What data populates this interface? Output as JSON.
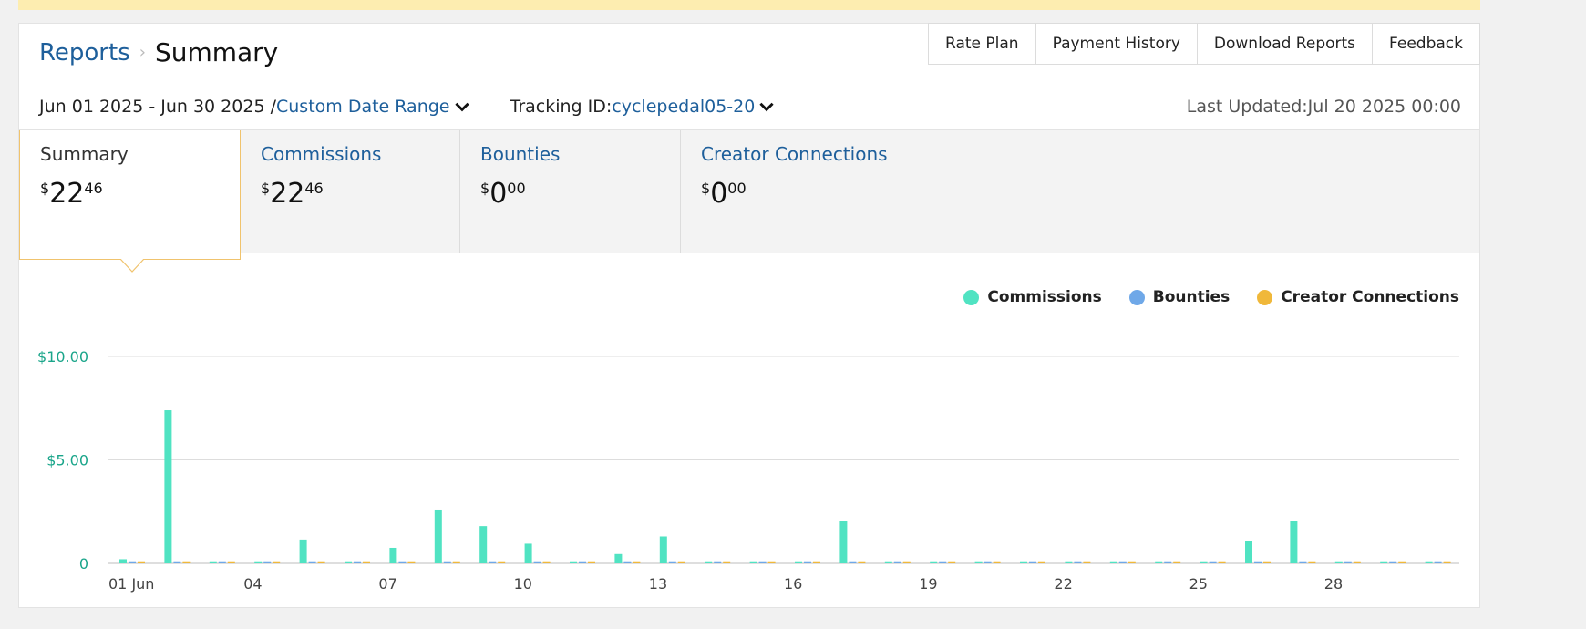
{
  "breadcrumb": {
    "parent": "Reports",
    "separator": "›",
    "current": "Summary"
  },
  "header_tabs": [
    "Rate Plan",
    "Payment History",
    "Download Reports",
    "Feedback"
  ],
  "filters": {
    "date_range": "Jun 01 2025 - Jun 30 2025 /",
    "date_mode": "Custom Date Range",
    "tracking_label": "Tracking ID:",
    "tracking_id": "cyclepedal05-20",
    "last_updated": "Last Updated:Jul 20 2025 00:00"
  },
  "metrics": [
    {
      "label": "Summary",
      "currency": "$",
      "whole": "22",
      "cents": "46",
      "active": true
    },
    {
      "label": "Commissions",
      "currency": "$",
      "whole": "22",
      "cents": "46",
      "active": false
    },
    {
      "label": "Bounties",
      "currency": "$",
      "whole": "0",
      "cents": "00",
      "active": false
    },
    {
      "label": "Creator Connections",
      "currency": "$",
      "whole": "0",
      "cents": "00",
      "active": false
    }
  ],
  "colors": {
    "commissions": "#50e3c2",
    "bounties": "#6fa8e8",
    "creator_connections": "#f0b83a",
    "accent_link": "#1e5f9b",
    "y_tick": "#1aa58a"
  },
  "chart_data": {
    "type": "bar",
    "x": [
      "01 Jun",
      "02",
      "03",
      "04",
      "05",
      "06",
      "07",
      "08",
      "09",
      "10",
      "11",
      "12",
      "13",
      "14",
      "15",
      "16",
      "17",
      "18",
      "19",
      "20",
      "21",
      "22",
      "23",
      "24",
      "25",
      "26",
      "27",
      "28",
      "29",
      "30"
    ],
    "x_tick_labels": [
      "01 Jun",
      "04",
      "07",
      "10",
      "13",
      "16",
      "19",
      "22",
      "25",
      "28"
    ],
    "y_ticks": [
      "$10.00",
      "$5.00",
      "0"
    ],
    "ylim": [
      0,
      10
    ],
    "series": [
      {
        "name": "Commissions",
        "values": [
          0.2,
          7.4,
          0.1,
          0.1,
          1.15,
          0.1,
          0.75,
          2.6,
          1.8,
          0.95,
          0.1,
          0.45,
          1.3,
          0.1,
          0.1,
          0.1,
          2.05,
          0.1,
          0.1,
          0.1,
          0.1,
          0.1,
          0.1,
          0.1,
          0.1,
          1.1,
          2.05,
          0.1,
          0.1,
          0.1
        ]
      },
      {
        "name": "Bounties",
        "values": [
          0.1,
          0.1,
          0.1,
          0.1,
          0.1,
          0.1,
          0.1,
          0.1,
          0.1,
          0.1,
          0.1,
          0.1,
          0.1,
          0.1,
          0.1,
          0.1,
          0.1,
          0.1,
          0.1,
          0.1,
          0.1,
          0.1,
          0.1,
          0.1,
          0.1,
          0.1,
          0.1,
          0.1,
          0.1,
          0.1
        ]
      },
      {
        "name": "Creator Connections",
        "values": [
          0.1,
          0.1,
          0.1,
          0.1,
          0.1,
          0.1,
          0.1,
          0.1,
          0.1,
          0.1,
          0.1,
          0.1,
          0.1,
          0.1,
          0.1,
          0.1,
          0.1,
          0.1,
          0.1,
          0.1,
          0.1,
          0.1,
          0.1,
          0.1,
          0.1,
          0.1,
          0.1,
          0.1,
          0.1,
          0.1
        ]
      }
    ],
    "grid": true,
    "legend": "top-right"
  }
}
